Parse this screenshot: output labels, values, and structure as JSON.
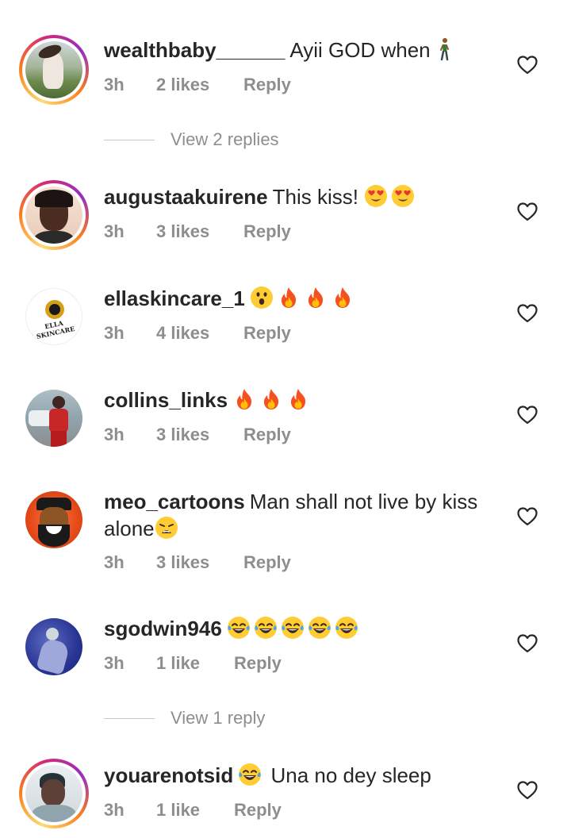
{
  "comments": [
    {
      "username": "wealthbaby______",
      "text": "Ayii GOD when",
      "time": "3h",
      "likes": "2 likes",
      "reply": "Reply",
      "view_replies": "View 2 replies"
    },
    {
      "username": "augustaakuirene",
      "text": "This kiss!",
      "time": "3h",
      "likes": "3 likes",
      "reply": "Reply"
    },
    {
      "username": "ellaskincare_1",
      "text": "",
      "time": "3h",
      "likes": "4 likes",
      "reply": "Reply",
      "avatar_text": "ELLA SKINCARE"
    },
    {
      "username": "collins_links",
      "text": "",
      "time": "3h",
      "likes": "3 likes",
      "reply": "Reply"
    },
    {
      "username": "meo_cartoons",
      "text": "Man shall not live by kiss alone",
      "time": "3h",
      "likes": "3 likes",
      "reply": "Reply"
    },
    {
      "username": "sgodwin946",
      "text": "",
      "time": "3h",
      "likes": "1 like",
      "reply": "Reply",
      "view_replies": "View 1 reply"
    },
    {
      "username": "youarenotsid",
      "text": "Una no dey sleep",
      "time": "3h",
      "likes": "1 like",
      "reply": "Reply"
    }
  ],
  "icons": {
    "like": "heart-outline-icon"
  },
  "colors": {
    "meta_text": "#8e8e8e",
    "body_text": "#262626"
  }
}
